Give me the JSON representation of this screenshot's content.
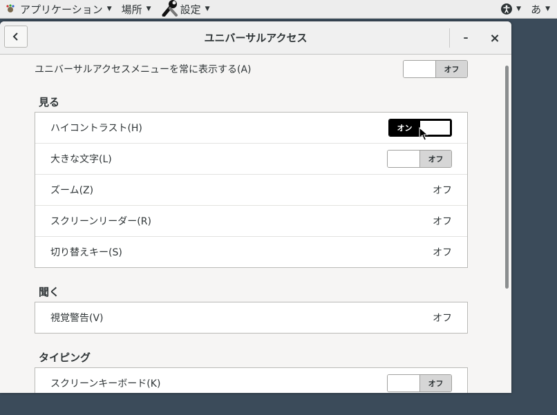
{
  "topbar": {
    "applications": "アプリケーション",
    "places": "場所",
    "settings": "設定",
    "input_method": "あ"
  },
  "window": {
    "title": "ユニバーサルアクセス",
    "minimize": "–",
    "close": "×"
  },
  "always_show": {
    "label": "ユニバーサルアクセスメニューを常に表示する(A)",
    "state": "オフ"
  },
  "sections": {
    "seeing": {
      "title": "見る",
      "rows": [
        {
          "label": "ハイコントラスト(H)",
          "state": "オン"
        },
        {
          "label": "大きな文字(L)",
          "state": "オフ"
        },
        {
          "label": "ズーム(Z)",
          "value": "オフ"
        },
        {
          "label": "スクリーンリーダー(R)",
          "value": "オフ"
        },
        {
          "label": "切り替えキー(S)",
          "value": "オフ"
        }
      ]
    },
    "hearing": {
      "title": "聞く",
      "rows": [
        {
          "label": "視覚警告(V)",
          "value": "オフ"
        }
      ]
    },
    "typing": {
      "title": "タイピング",
      "rows": [
        {
          "label": "スクリーンキーボード(K)",
          "state": "オフ"
        }
      ]
    }
  },
  "colors": {
    "background": "#3b4b5a",
    "window": "#f6f5f4",
    "switch_on": "#000000"
  }
}
